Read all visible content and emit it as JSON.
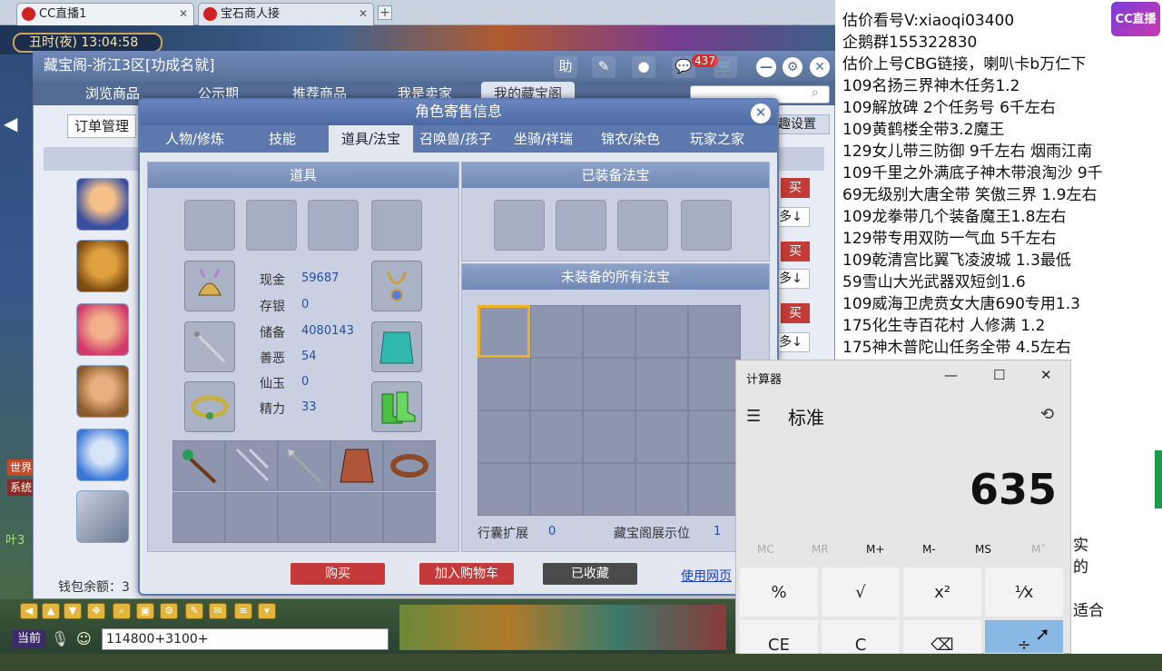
{
  "browser": {
    "tabs": [
      {
        "label": "CC直播1"
      },
      {
        "label": "宝石商人接"
      }
    ],
    "new_tab": "+"
  },
  "game": {
    "clock": "丑时(夜) 13:04:58",
    "chat_input": "114800+3100+",
    "channel": "当前",
    "side_labels": [
      "世界",
      "系统",
      "叶3"
    ]
  },
  "cbg": {
    "title": "藏宝阁-浙江3区[功成名就]",
    "nav": [
      "浏览商品",
      "公示期",
      "推荐商品",
      "我是卖家",
      "我的藏宝阁"
    ],
    "order_tab": "订单管理",
    "settings": "趣设置",
    "badge": "437",
    "icons": [
      "助",
      "✎",
      "●",
      "💬",
      "🛒"
    ],
    "buy_label": "买",
    "arrow_label": "多↓",
    "wallet": "钱包余额：3"
  },
  "dialog": {
    "title": "角色寄售信息",
    "tabs": [
      "人物/修炼",
      "技能",
      "道具/法宝",
      "召唤兽/孩子",
      "坐骑/祥瑞",
      "锦衣/染色",
      "玩家之家"
    ],
    "items_header": "道具",
    "equipped_header": "已装备法宝",
    "unequipped_header": "未装备的所有法宝",
    "stats": [
      {
        "label": "现金",
        "value": "59687"
      },
      {
        "label": "存银",
        "value": "0"
      },
      {
        "label": "储备",
        "value": "4080143"
      },
      {
        "label": "善恶",
        "value": "54"
      },
      {
        "label": "仙玉",
        "value": "0"
      },
      {
        "label": "精力",
        "value": "33"
      }
    ],
    "bag_expand_label": "行囊扩展",
    "bag_expand_value": "0",
    "cbg_slot_label": "藏宝阁展示位",
    "cbg_slot_value": "1",
    "buttons": {
      "buy": "购买",
      "cart": "加入购物车",
      "favorited": "已收藏",
      "web": "使用网页"
    }
  },
  "right_text": [
    "估价看号V:xiaoqi03400",
    "企鹅群155322830",
    "估价上号CBG链接，喇叭卡b万仁下",
    "109名扬三界神木任务1.2",
    "109解放碑 2个任务号 6千左右",
    "109黄鹤楼全带3.2魔王",
    "129女儿带三防御 9千左右 烟雨江南",
    "109千里之外满底子神木带浪淘沙 9千",
    "69无级别大唐全带  笑傲三界 1.9左右",
    "109龙拳带几个装备魔王1.8左右",
    "129带专用双防一气血 5千左右",
    "109乾清宫比翼飞凌波城 1.3最低",
    "59雪山大光武器双短剑1.6",
    "109威海卫虎贲女大唐690专用1.3",
    "175化生寺百花村 人修满 1.2",
    "175神木普陀山任务全带 4.5左右"
  ],
  "right_fragments": [
    "实",
    "的",
    "适合"
  ],
  "cc_logo": "CC直播",
  "calculator": {
    "title": "计算器",
    "mode": "标准",
    "display": "635",
    "memory": [
      "MC",
      "MR",
      "M+",
      "M-",
      "MS",
      "M˅"
    ],
    "keys_row1": [
      "%",
      "√",
      "x²",
      "¹⁄x"
    ],
    "keys_row2": [
      "CE",
      "C",
      "⌫",
      "÷"
    ]
  }
}
